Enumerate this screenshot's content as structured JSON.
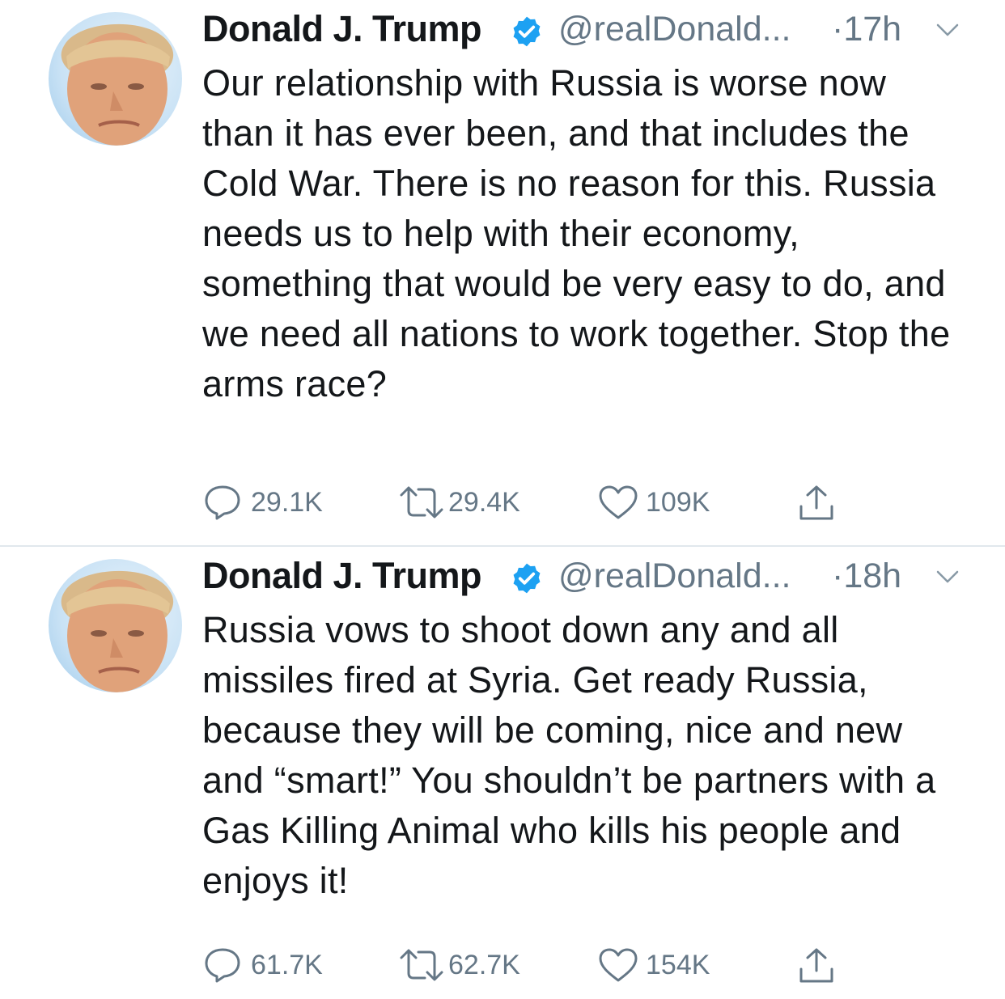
{
  "colors": {
    "text": "#14171a",
    "secondary": "#657786",
    "verified": "#1da1f2",
    "divider": "#e1e8ed"
  },
  "tweets": [
    {
      "name": "Donald J. Trump",
      "handle": "@realDonald...",
      "time": "·17h",
      "text": "Our relationship with Russia is worse now than it has ever been, and that includes the Cold War. There is no reason for this. Russia needs us to help with their economy, something that would be very easy to do, and we need all nations to work together. Stop the arms race?",
      "replies": "29.1K",
      "retweets": "29.4K",
      "likes": "109K",
      "icons": {
        "reply": "reply-icon",
        "retweet": "retweet-icon",
        "like": "heart-icon",
        "share": "share-icon",
        "verified": "verified-badge-icon",
        "caret": "chevron-down-icon"
      }
    },
    {
      "name": "Donald J. Trump",
      "handle": "@realDonald...",
      "time": "·18h",
      "text": "Russia vows to shoot down any and all missiles fired at Syria. Get ready Russia, because they will be coming, nice and new and “smart!” You shouldn’t be partners with a Gas Killing Animal who kills his people and enjoys it!",
      "replies": "61.7K",
      "retweets": "62.7K",
      "likes": "154K",
      "icons": {
        "reply": "reply-icon",
        "retweet": "retweet-icon",
        "like": "heart-icon",
        "share": "share-icon",
        "verified": "verified-badge-icon",
        "caret": "chevron-down-icon"
      }
    }
  ]
}
